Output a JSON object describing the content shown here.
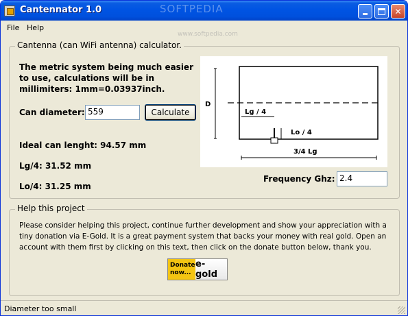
{
  "window": {
    "title": "Cantennator 1.0",
    "watermark": "SOFTPEDIA",
    "watermark_url": "www.softpedia.com"
  },
  "menu": {
    "file": "File",
    "help": "Help"
  },
  "calculator": {
    "group_label": "Cantenna (can WiFi antenna) calculator.",
    "note": "The metric system being much easier to use, calculations will be in millimiters: 1mm=0.03937inch.",
    "can_diameter_label": "Can diameter:",
    "can_diameter_value": "559",
    "calculate_label": "Calculate",
    "ideal_length": "Ideal can lenght: 94.57 mm",
    "lg4": "Lg/4:  31.52 mm",
    "lo4": "Lo/4:  31.25 mm",
    "frequency_label": "Frequency Ghz:",
    "frequency_value": "2.4",
    "diagram": {
      "d_label": "D",
      "lg4_label": "Lg / 4",
      "lo4_label": "Lo / 4",
      "lg34_label": "3/4 Lg"
    }
  },
  "help_project": {
    "group_label": "Help this project",
    "text": "Please consider helping this project, continue further development and show your appreciation with a tiny donation via E-Gold. It is a great payment system that backs your money with real gold. Open an account with them first by clicking on this text, then click on the donate button below, thank you.",
    "donate_line1": "Donate",
    "donate_line2": "now...",
    "donate_brand": "e-gold"
  },
  "status": {
    "text": "Diameter too small"
  },
  "colors": {
    "titlebar": "#0054e3",
    "face": "#ece9d8",
    "egold": "#f3c412"
  }
}
